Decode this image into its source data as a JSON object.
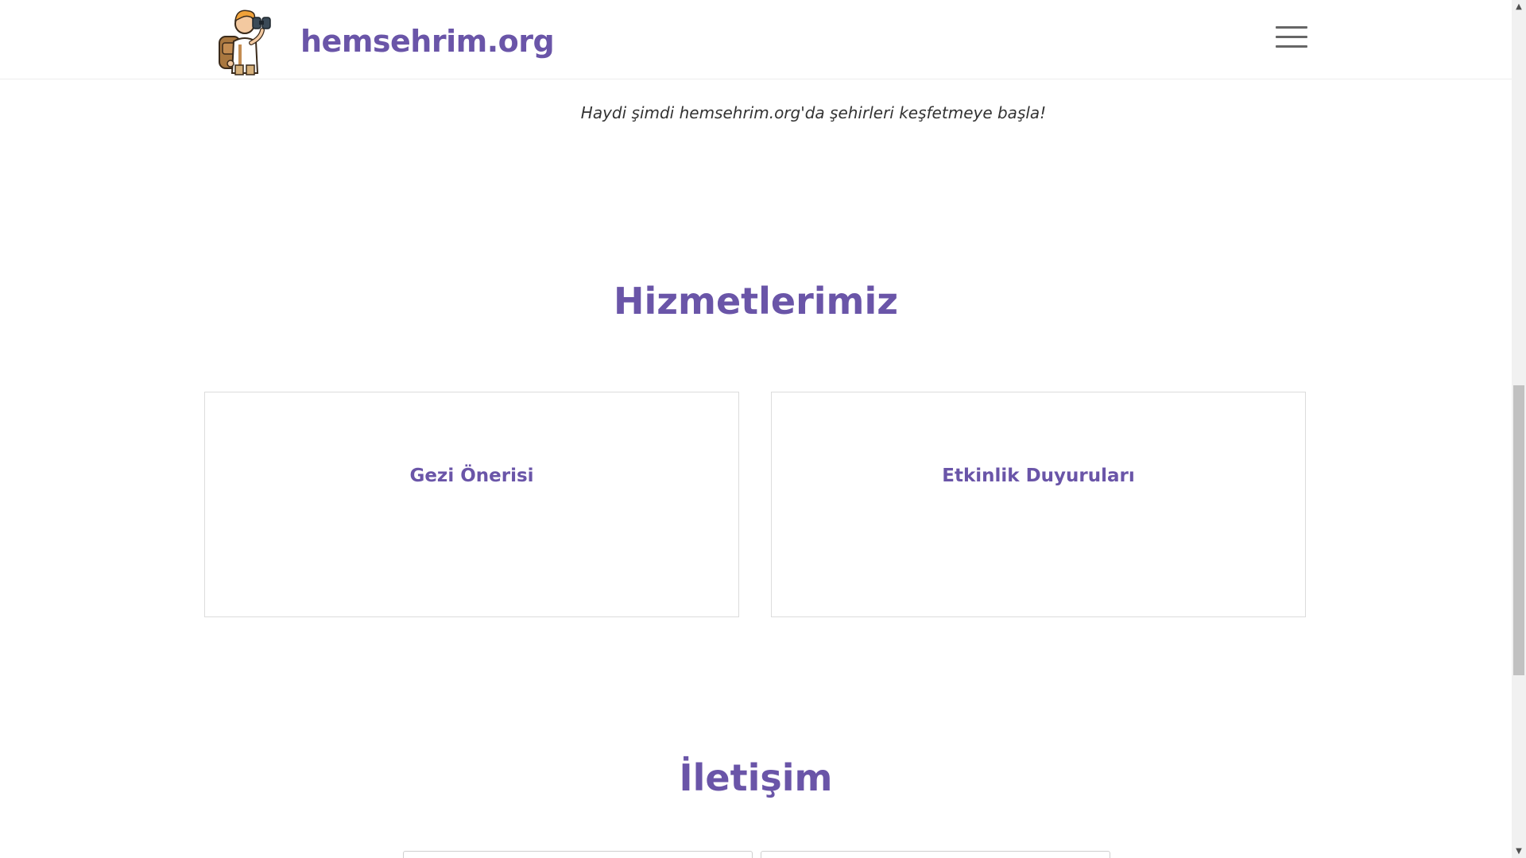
{
  "header": {
    "brand": "hemsehrim.org",
    "logo_icon": "traveler-with-binoculars-icon",
    "menu_icon": "hamburger-menu-icon"
  },
  "hero": {
    "tagline": "Haydi şimdi hemsehrim.org'da şehirleri keşfetmeye başla!"
  },
  "services": {
    "title": "Hizmetlerimiz",
    "cards": [
      {
        "label": "Gezi Önerisi"
      },
      {
        "label": "Etkinlik Duyuruları"
      }
    ]
  },
  "contact": {
    "title": "İletişim"
  },
  "scrollbar": {
    "up_icon": "chevron-up-icon",
    "down_icon": "chevron-down-icon"
  },
  "colors": {
    "brand": "#6a55a8",
    "text": "#333333",
    "border": "#dcdcdc"
  }
}
